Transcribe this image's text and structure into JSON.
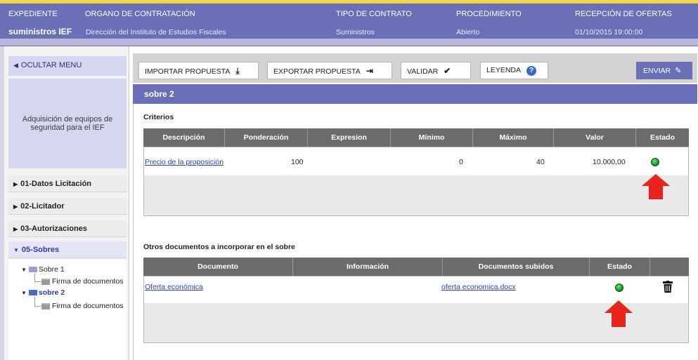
{
  "header": {
    "expediente_label": "EXPEDIENTE",
    "expediente_value": "suministros IEF",
    "organo_label": "ORGANO DE CONTRATACIÓN",
    "organo_value": "Dirección del Instituto de Estudios Fiscales",
    "tipo_label": "TIPO DE CONTRATO",
    "tipo_value": "Suministros",
    "procedimiento_label": "PROCEDIMIENTO",
    "procedimiento_value": "Abierto",
    "recepcion_label": "RECEPCIÓN DE OFERTAS",
    "recepcion_value": "01/10/2015 19:00:00"
  },
  "sidebar": {
    "toggle_label": "OCULTAR MENU",
    "description": "Adquisición de equipos de seguridad para el IEF",
    "items": [
      {
        "label": "01-Datos Licitación"
      },
      {
        "label": "02-Licitador"
      },
      {
        "label": "03-Autorizaciones"
      },
      {
        "label": "05-Sobres"
      }
    ],
    "tree": {
      "sobre1": "Sobre 1",
      "sobre1_child": "Firma de documentos",
      "sobre2": "sobre 2",
      "sobre2_child": "Firma de documentos"
    }
  },
  "toolbar": {
    "import_label": "IMPORTAR PROPUESTA",
    "export_label": "EXPORTAR PROPUESTA",
    "validate_label": "VALIDAR",
    "legend_label": "LEYENDA",
    "send_label": "ENVIAR"
  },
  "section": {
    "title": "sobre 2"
  },
  "criterios": {
    "title": "Criterios",
    "headers": [
      "Descripción",
      "Ponderación",
      "Expresion",
      "Mínimo",
      "Máximo",
      "Valor",
      "Estado"
    ],
    "rows": [
      {
        "descripcion": "Precio de la proposición",
        "ponderacion": "100",
        "expresion": "",
        "minimo": "0",
        "maximo": "40",
        "valor": "10.000,00",
        "estado": "ok"
      }
    ]
  },
  "documentos": {
    "title": "Otros documentos a incorporar en el sobre",
    "headers": [
      "Documento",
      "Información",
      "Documentos subidos",
      "Estado",
      ""
    ],
    "rows": [
      {
        "documento": "Oferta económica",
        "informacion": "",
        "subido": "oferta economica.docx",
        "estado": "ok"
      }
    ]
  },
  "colors": {
    "header_bg": "#6a6fb7",
    "table_header": "#6b6b6b",
    "status_green": "#1aa52a",
    "arrow_red": "#e8231c",
    "link": "#2a3ad0"
  }
}
